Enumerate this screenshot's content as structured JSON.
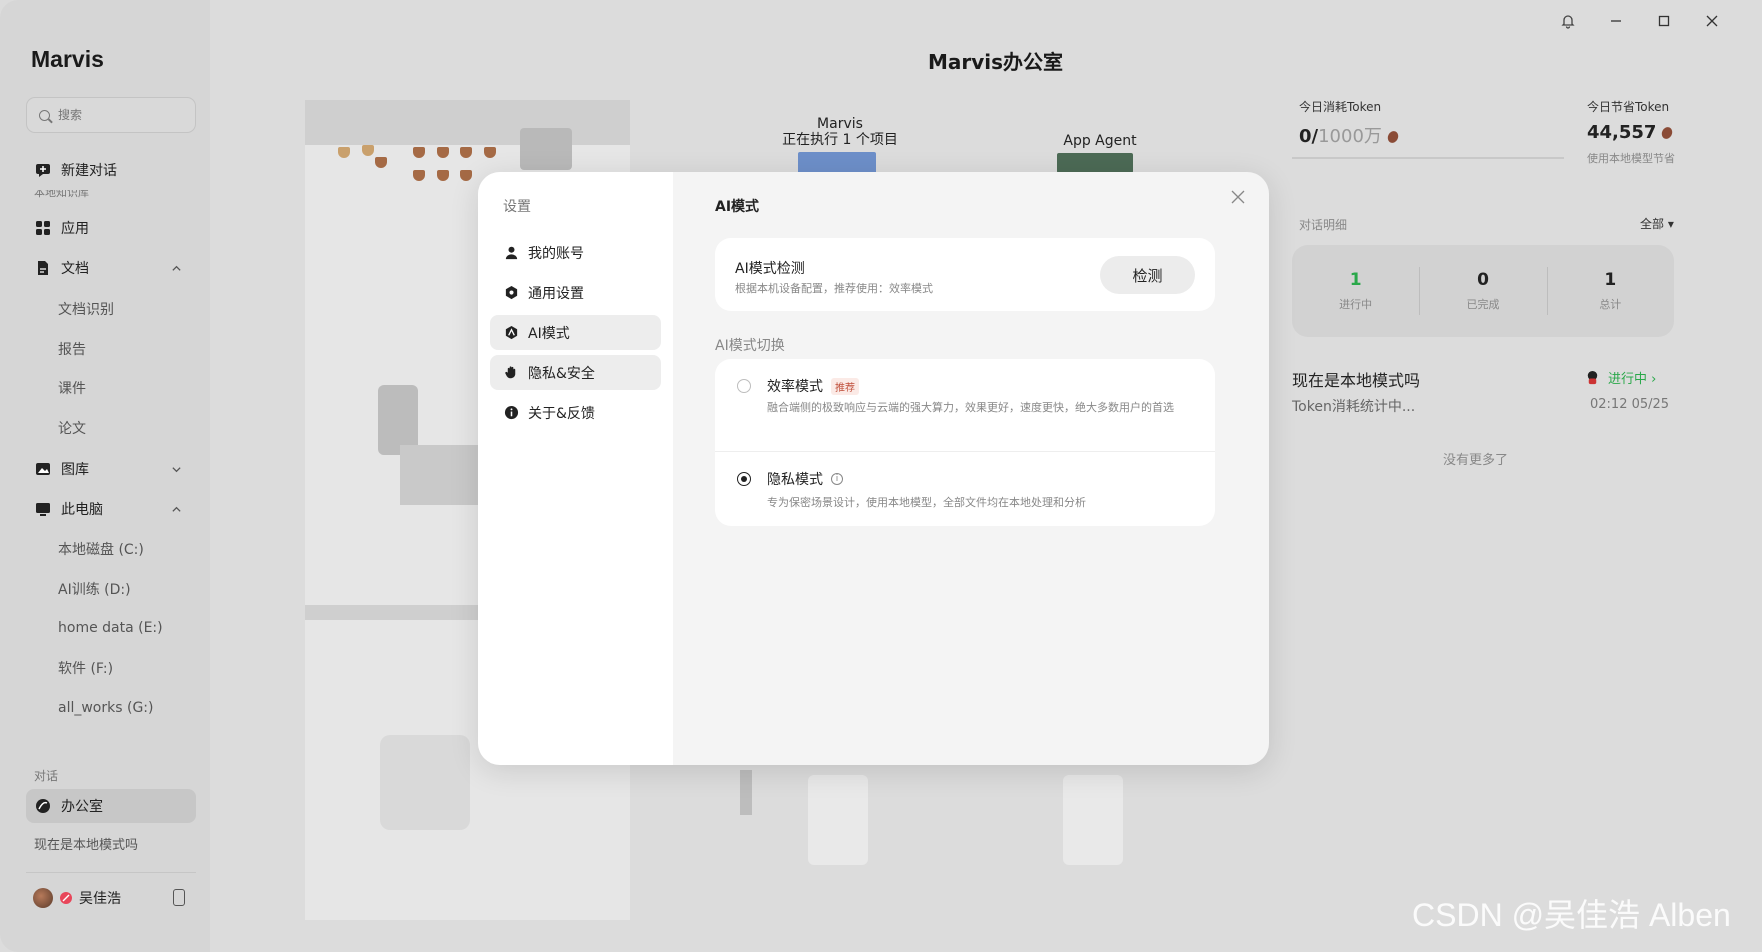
{
  "app": {
    "brand": "Marvis",
    "title": "Marvis办公室"
  },
  "sidebar": {
    "search_placeholder": "搜索",
    "new_chat": "新建对话",
    "cut_label": "本地知识库",
    "items": [
      {
        "label": "应用"
      },
      {
        "label": "文档"
      },
      {
        "label": "文档识别"
      },
      {
        "label": "报告"
      },
      {
        "label": "课件"
      },
      {
        "label": "论文"
      },
      {
        "label": "图库"
      },
      {
        "label": "此电脑"
      },
      {
        "label": "本地磁盘 (C:)"
      },
      {
        "label": "AI训练 (D:)"
      },
      {
        "label": "home data (E:)"
      },
      {
        "label": "软件 (F:)"
      },
      {
        "label": "all_works (G:)"
      }
    ],
    "section_label": "对话",
    "office_item": "办公室",
    "conversation_item": "现在是本地模式吗",
    "user_name": "吴佳浩"
  },
  "scene": {
    "marvis_label": "Marvis",
    "marvis_status": "正在执行 1 个项目",
    "agent_label": "App Agent"
  },
  "right_panel": {
    "today_token_label": "今日消耗Token",
    "today_token_used": "0/",
    "today_token_total": "1000万",
    "saved_token_label": "今日节省Token",
    "saved_token_value": "44,557",
    "saved_note": "使用本地模型节省",
    "detail_label": "对话明细",
    "filter": "全部 ▾",
    "stats": [
      {
        "value": "1",
        "label": "进行中"
      },
      {
        "value": "0",
        "label": "已完成"
      },
      {
        "value": "1",
        "label": "总计"
      }
    ],
    "conv_title": "现在是本地模式吗",
    "conv_sub": "Token消耗统计中...",
    "conv_status": "进行中 ›",
    "conv_time": "02:12 05/25",
    "no_more": "没有更多了"
  },
  "modal": {
    "settings_title": "设置",
    "menu": [
      {
        "label": "我的账号"
      },
      {
        "label": "通用设置"
      },
      {
        "label": "AI模式"
      },
      {
        "label": "隐私&安全"
      },
      {
        "label": "关于&反馈"
      }
    ],
    "ai_title": "AI模式",
    "detect_title": "AI模式检测",
    "detect_desc": "根据本机设备配置，推荐使用：效率模式",
    "detect_button": "检测",
    "switch_label": "AI模式切换",
    "options": [
      {
        "title": "效率模式",
        "tag": "推荐",
        "desc": "融合端侧的极致响应与云端的强大算力，效果更好，速度更快，绝大多数用户的首选",
        "checked": false
      },
      {
        "title": "隐私模式",
        "info": "i",
        "desc": "专为保密场景设计，使用本地模型，全部文件均在本地处理和分析",
        "checked": true
      }
    ]
  },
  "watermark": "CSDN @吴佳浩 Alben"
}
